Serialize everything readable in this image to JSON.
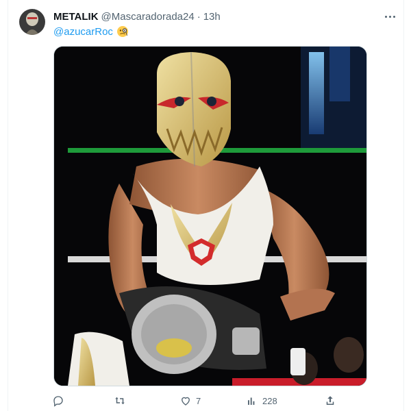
{
  "tweet": {
    "display_name": "METALIK",
    "handle": "@Mascaradorada24",
    "separator": "·",
    "time": "13h",
    "mention": "@azucarRoc",
    "emoji_icon": "face-with-monocle-icon"
  },
  "actions": {
    "reply_icon": "reply-icon",
    "retweet_icon": "retweet-icon",
    "like_icon": "heart-icon",
    "likes_count": "7",
    "views_icon": "views-icon",
    "views_count": "228",
    "share_icon": "share-icon"
  },
  "colors": {
    "accent": "#1d9bf0",
    "muted": "#536471",
    "mask_gold": "#d9bf6e",
    "ring_rope_green": "#1e9a3a"
  }
}
